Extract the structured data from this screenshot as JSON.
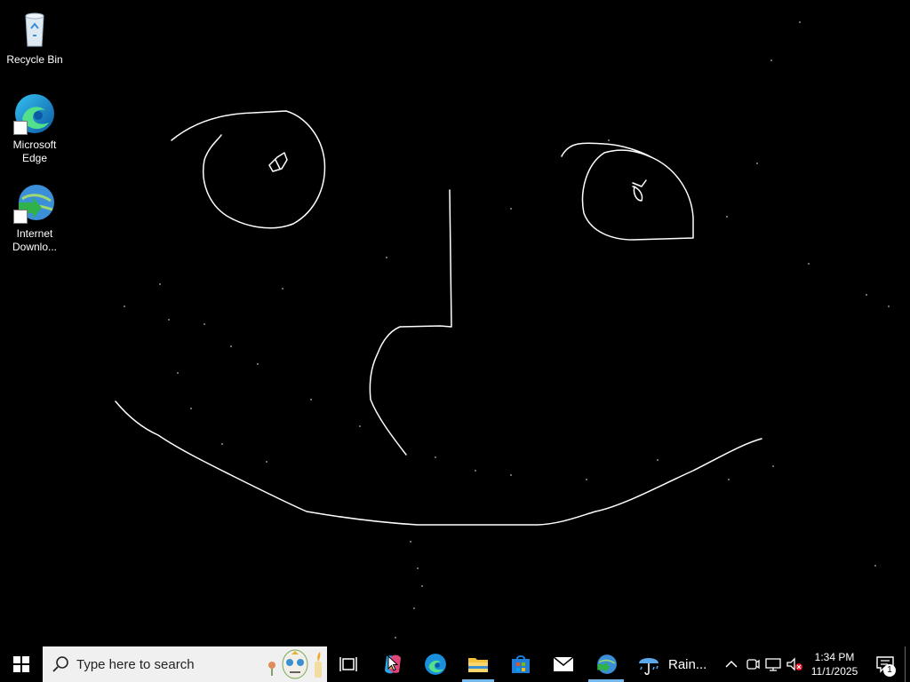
{
  "desktop": {
    "icons": [
      {
        "label": "Recycle Bin",
        "icon": "recycle-bin-icon"
      },
      {
        "label": "Microsoft Edge",
        "icon": "edge-icon"
      },
      {
        "label": "Internet Downlo...",
        "icon": "internet-download-manager-icon"
      }
    ]
  },
  "taskbar": {
    "search_placeholder": "Type here to search",
    "apps": [
      "copilot-icon",
      "edge-icon",
      "file-explorer-icon",
      "microsoft-store-icon",
      "mail-icon",
      "internet-download-manager-icon"
    ],
    "weather": {
      "text": "Rain...",
      "icon": "rain-umbrella-icon"
    },
    "clock": {
      "time": "1:34 PM",
      "date": "11/1/2025"
    },
    "notifications_count": "1",
    "accent": "#76b9ed"
  }
}
